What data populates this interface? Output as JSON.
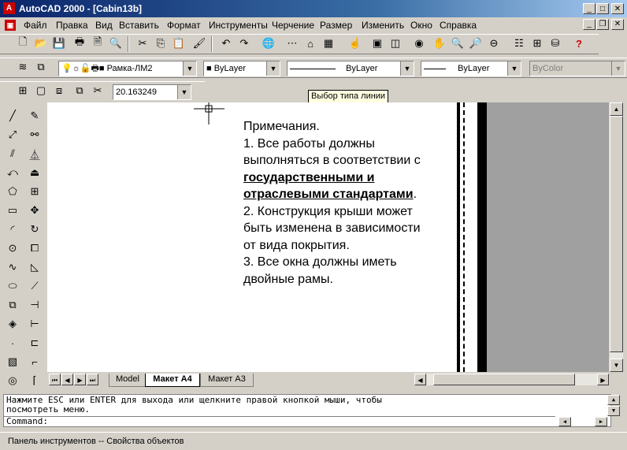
{
  "window": {
    "title": "AutoCAD 2000 - [Cabin13b]",
    "app_icon": "A"
  },
  "menu": [
    "Файл",
    "Правка",
    "Вид",
    "Вставить",
    "Формат",
    "Инструменты",
    "Черчение",
    "Размер",
    "Изменить",
    "Окно",
    "Справка"
  ],
  "properties_toolbar": {
    "layer": "Рамка-ЛМ2",
    "color": "ByLayer",
    "linetype": "ByLayer",
    "lineweight": "ByLayer",
    "plotstyle": "ByColor",
    "tooltip": "Выбор типа линии"
  },
  "viewport_toolbar": {
    "scale": "20.163249"
  },
  "notes": {
    "l1": "Примечания.",
    "l2": "1. Все работы должны",
    "l3": "выполняться в соответствии с",
    "l4": "государственными и",
    "l5a": "отраслевыми стандартами",
    "l5b": ".",
    "l6": "2. Конструкция крыши может",
    "l7": "быть изменена в зависимости",
    "l8": "от вида покрытия.",
    "l9": "3. Все окна должны иметь",
    "l10": "двойные рамы."
  },
  "tabs": [
    "Model",
    "Макет A4",
    "Макет A3"
  ],
  "active_tab": "Макет A4",
  "command": {
    "line1": "Нажмите ESC или ENTER для выхода или щелкните правой кнопкой мыши, чтобы",
    "line2": "посмотреть меню.",
    "prompt": "Command:"
  },
  "status": "Панель инструментов -- Свойства объектов",
  "colors": {
    "titlebar": "#0a246a",
    "face": "#d4d0c8",
    "paper_bg": "#a0a0a0"
  }
}
